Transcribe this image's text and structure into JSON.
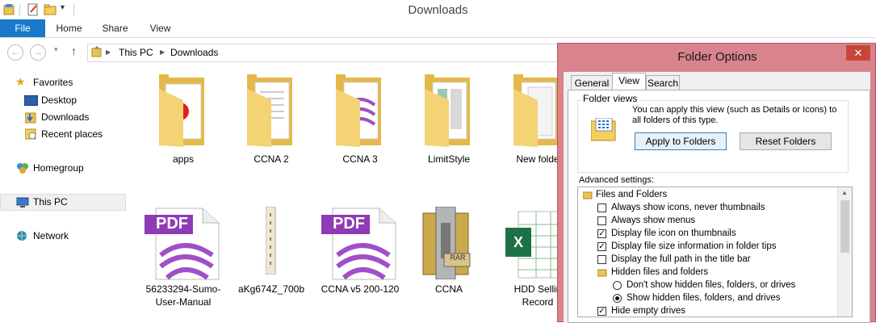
{
  "window": {
    "title": "Downloads"
  },
  "ribbon": {
    "tabs": [
      "File",
      "Home",
      "Share",
      "View"
    ]
  },
  "address": {
    "path": [
      "This PC",
      "Downloads"
    ]
  },
  "nav": {
    "favorites": "Favorites",
    "favorite_items": [
      "Desktop",
      "Downloads",
      "Recent places"
    ],
    "homegroup": "Homegroup",
    "this_pc": "This PC",
    "network": "Network"
  },
  "files": [
    {
      "name": "apps",
      "type": "folder"
    },
    {
      "name": "CCNA 2",
      "type": "folder"
    },
    {
      "name": "CCNA 3",
      "type": "folder"
    },
    {
      "name": "LimitStyle",
      "type": "folder"
    },
    {
      "name": "New folde",
      "type": "folder"
    },
    {
      "name": "56233294-Sumo-User-Manual",
      "line1": "56233294-Sumo-",
      "line2": "User-Manual",
      "type": "pdf"
    },
    {
      "name": "aKg674Z_700b",
      "type": "image"
    },
    {
      "name": "CCNA v5 200-120",
      "type": "pdf"
    },
    {
      "name": "CCNA",
      "type": "rar"
    },
    {
      "name": "HDD Sellin Record",
      "line1": "HDD Sellin",
      "line2": "Record",
      "type": "excel"
    }
  ],
  "icons": {
    "pdf_label": "PDF",
    "rar_label": "RAR",
    "excel_label": "X"
  },
  "dialog": {
    "title": "Folder Options",
    "close": "✕",
    "tabs": [
      "General",
      "View",
      "Search"
    ],
    "active_tab": "View",
    "folder_views": {
      "label": "Folder views",
      "desc1": "You can apply this view (such as Details or Icons) to",
      "desc2": "all folders of this type.",
      "apply_button": "Apply to Folders",
      "reset_button": "Reset Folders"
    },
    "advanced_label": "Advanced settings:",
    "settings": [
      {
        "kind": "folder",
        "label": "Files and Folders"
      },
      {
        "kind": "checkbox",
        "label": "Always show icons, never thumbnails",
        "checked": false
      },
      {
        "kind": "checkbox",
        "label": "Always show menus",
        "checked": false
      },
      {
        "kind": "checkbox",
        "label": "Display file icon on thumbnails",
        "checked": true
      },
      {
        "kind": "checkbox",
        "label": "Display file size information in folder tips",
        "checked": true
      },
      {
        "kind": "checkbox",
        "label": "Display the full path in the title bar",
        "checked": false
      },
      {
        "kind": "subfolder",
        "label": "Hidden files and folders"
      },
      {
        "kind": "radio",
        "label": "Don't show hidden files, folders, or drives",
        "selected": false
      },
      {
        "kind": "radio",
        "label": "Show hidden files, folders, and drives",
        "selected": true
      },
      {
        "kind": "checkbox",
        "label": "Hide empty drives",
        "checked": true
      }
    ]
  }
}
